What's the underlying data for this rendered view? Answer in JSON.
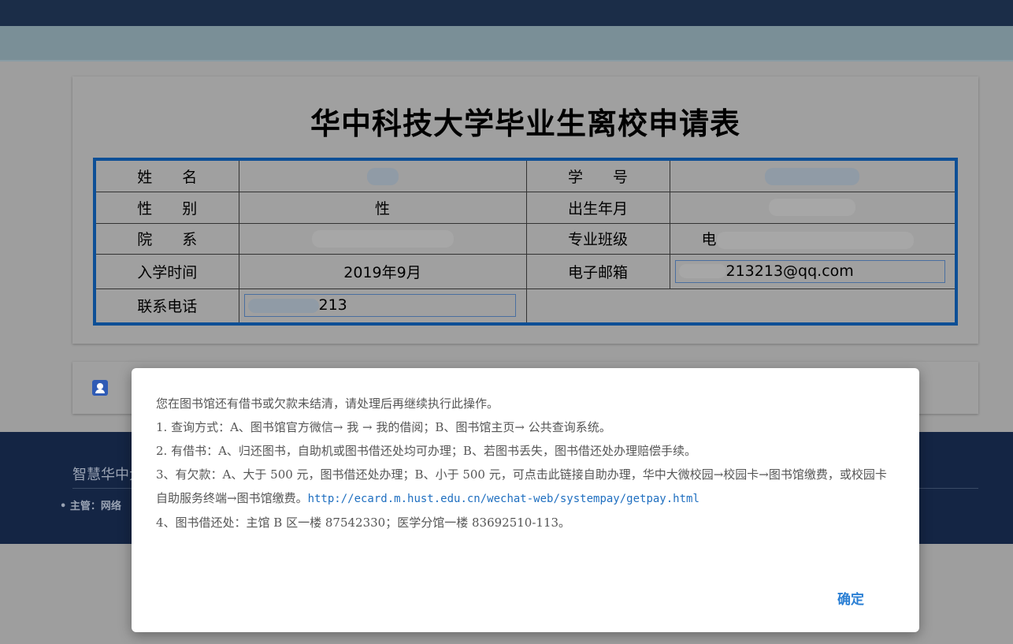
{
  "form": {
    "title": "华中科技大学毕业生离校申请表",
    "labels": {
      "name": "姓　　名",
      "student_id": "学　　号",
      "gender": "性　　别",
      "birth": "出生年月",
      "department": "院　　系",
      "major_class": "专业班级",
      "enroll_time": "入学时间",
      "email": "电子邮箱",
      "phone": "联系电话"
    },
    "values": {
      "gender": "性",
      "major_class_prefix": "电",
      "enroll_time": "2019年9月",
      "email": "213213@qq.com",
      "phone": "213"
    }
  },
  "footer": {
    "title": "智慧华中大",
    "sub": "• 主管：网络"
  },
  "dialog": {
    "lines": [
      "您在图书馆还有借书或欠款未结清，请处理后再继续执行此操作。",
      "1. 查询方式：A、图书馆官方微信→ 我 → 我的借阅；B、图书馆主页→ 公共查询系统。",
      "2. 有借书：A、归还图书，自助机或图书借还处均可办理；B、若图书丢失，图书借还处办理赔偿手续。",
      "3、有欠款：A、大于 500 元，图书借还处办理；B、小于 500 元，可点击此链接自助办理，华中大微校园→校园卡→图书馆缴费，或校园卡自助服务终端→图书馆缴费。"
    ],
    "link": "http://ecard.m.hust.edu.cn/wechat-web/systempay/getpay.html",
    "line4": "4、图书借还处：主馆 B 区一楼 87542330；医学分馆一楼 83692510-113。",
    "ok_label": "确定"
  },
  "colors": {
    "topbar": "#1b2d48",
    "table_border": "#0d4f96",
    "link": "#1f6fc0",
    "ok_button": "#2a7fd4"
  }
}
